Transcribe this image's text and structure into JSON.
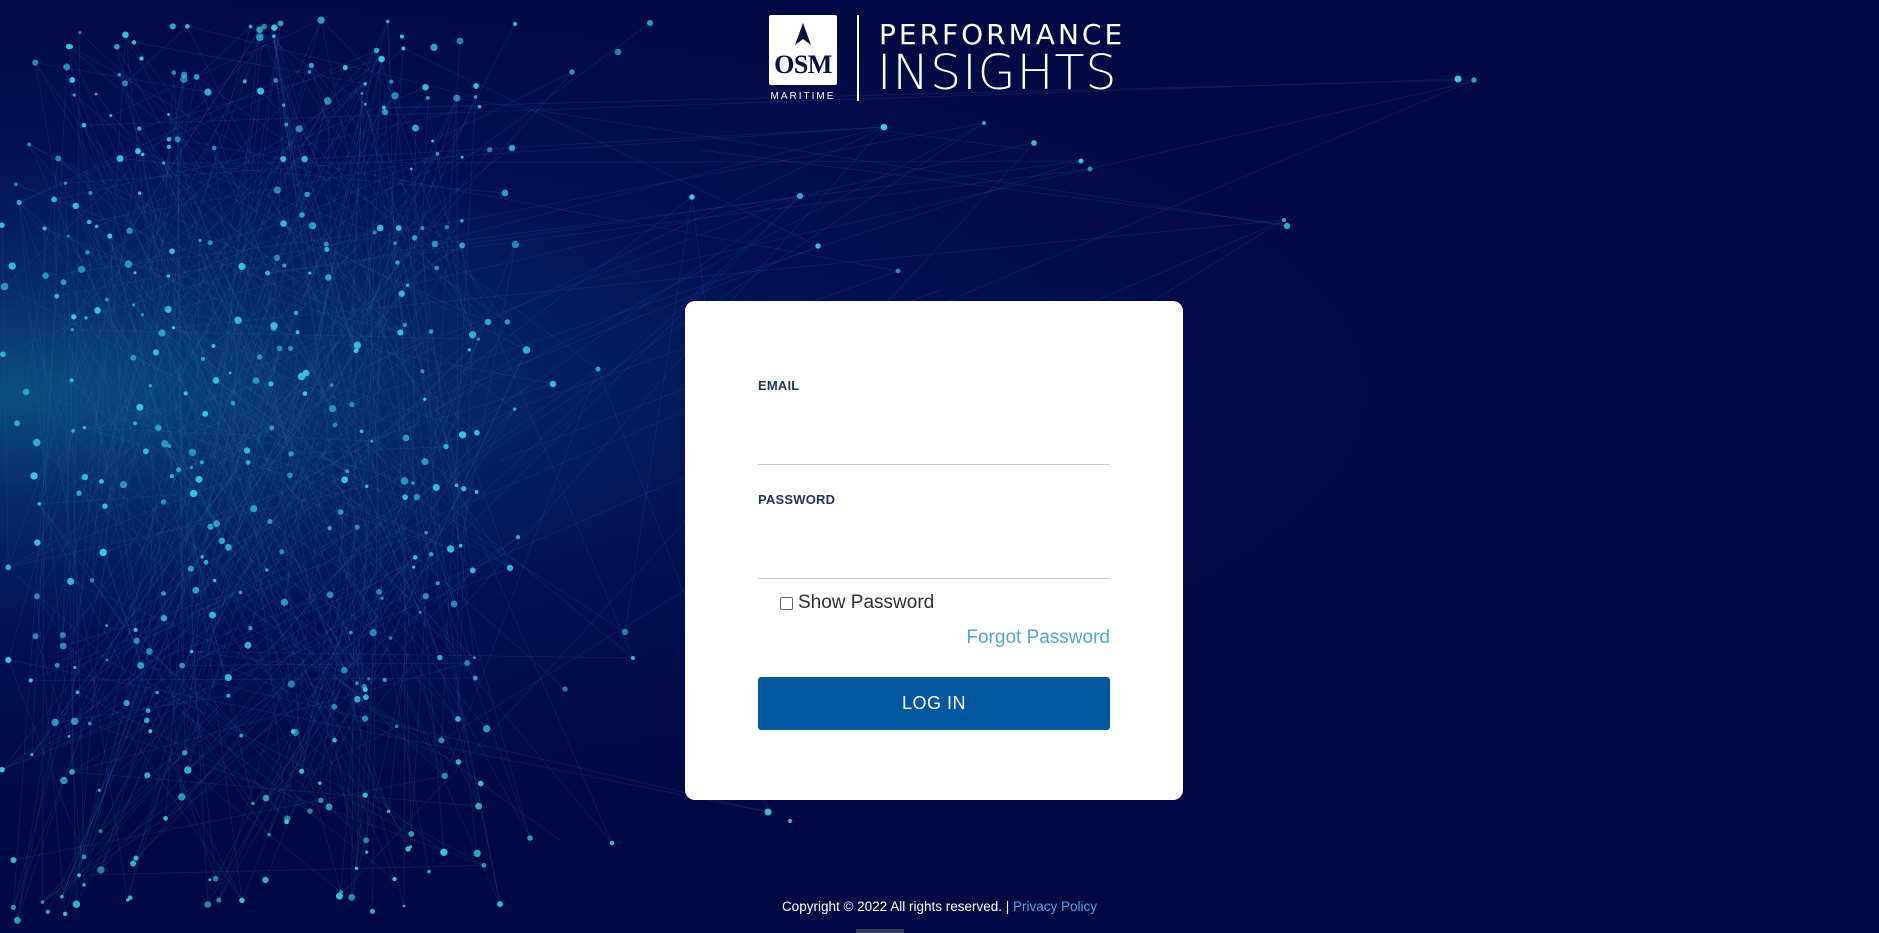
{
  "brand": {
    "logo_mark_text": "OSM",
    "logo_sub_text": "MARITIME",
    "product_line1": "PERFORMANCE",
    "product_line2": "INSIGHTS"
  },
  "login": {
    "email_label": "EMAIL",
    "email_value": "",
    "password_label": "PASSWORD",
    "password_value": "",
    "show_password_label": "Show Password",
    "show_password_checked": false,
    "forgot_password_label": "Forgot Password",
    "login_button_label": "LOG IN"
  },
  "footer": {
    "copyright": "Copyright © 2022 All rights reserved. |",
    "privacy_link": "Privacy Policy"
  },
  "colors": {
    "background": "#020a45",
    "accent_button": "#03579f",
    "link": "#4fa6d4",
    "particle": "#39c9e3"
  }
}
